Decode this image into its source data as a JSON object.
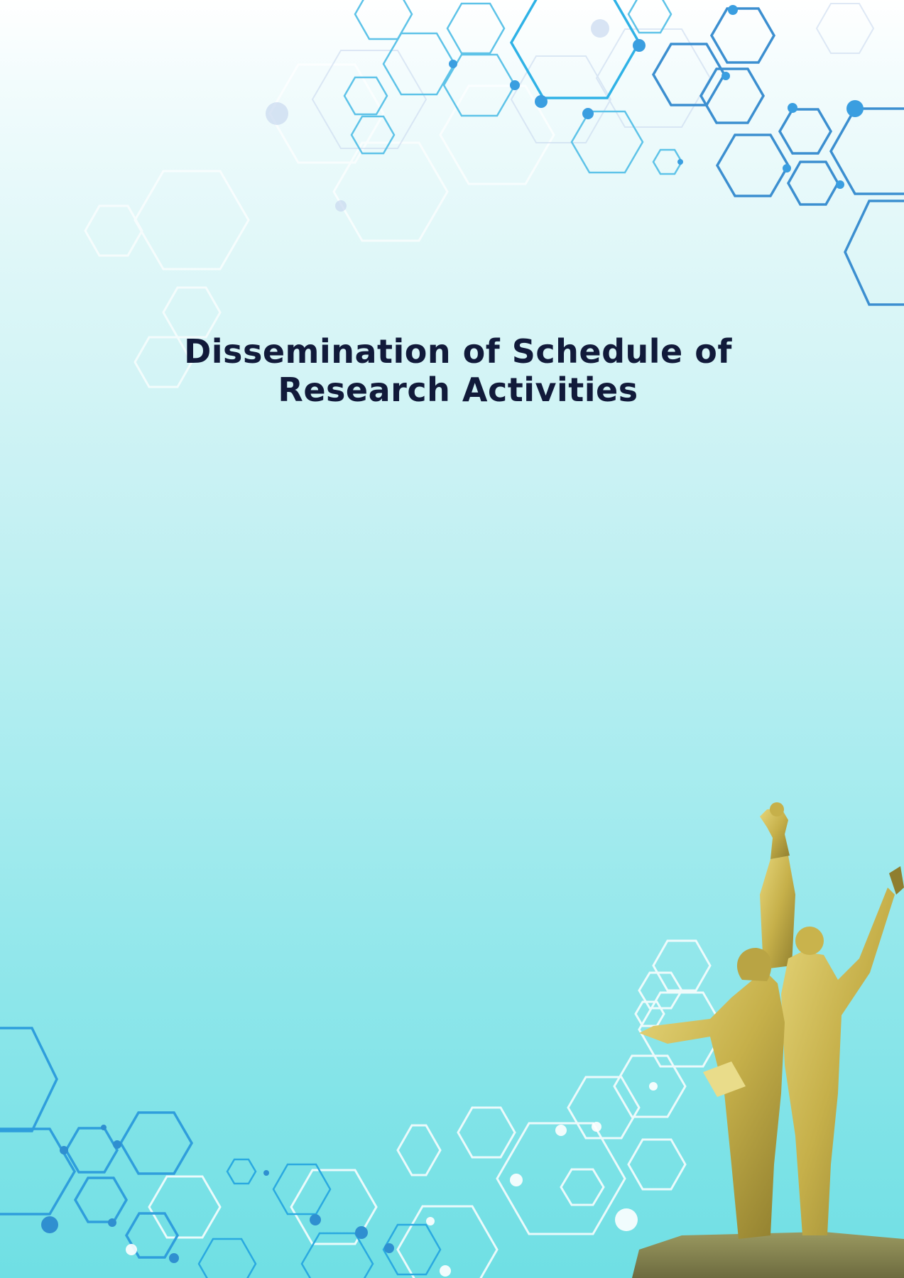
{
  "title": {
    "line1": "Dissemination of Schedule of",
    "line2": "Research Activities"
  },
  "colors": {
    "title": "#111a3a",
    "hex_dark": "#3a8fd0",
    "hex_mid": "#4fb8e4",
    "hex_light": "#ffffff",
    "statue_gold": "#c9b648",
    "background_bottom": "#6fdfe4"
  },
  "decorations": {
    "top_pattern": "hexagon-network-graphic",
    "bottom_pattern": "hexagon-network-graphic",
    "illustration": "golden-monument-statue"
  }
}
